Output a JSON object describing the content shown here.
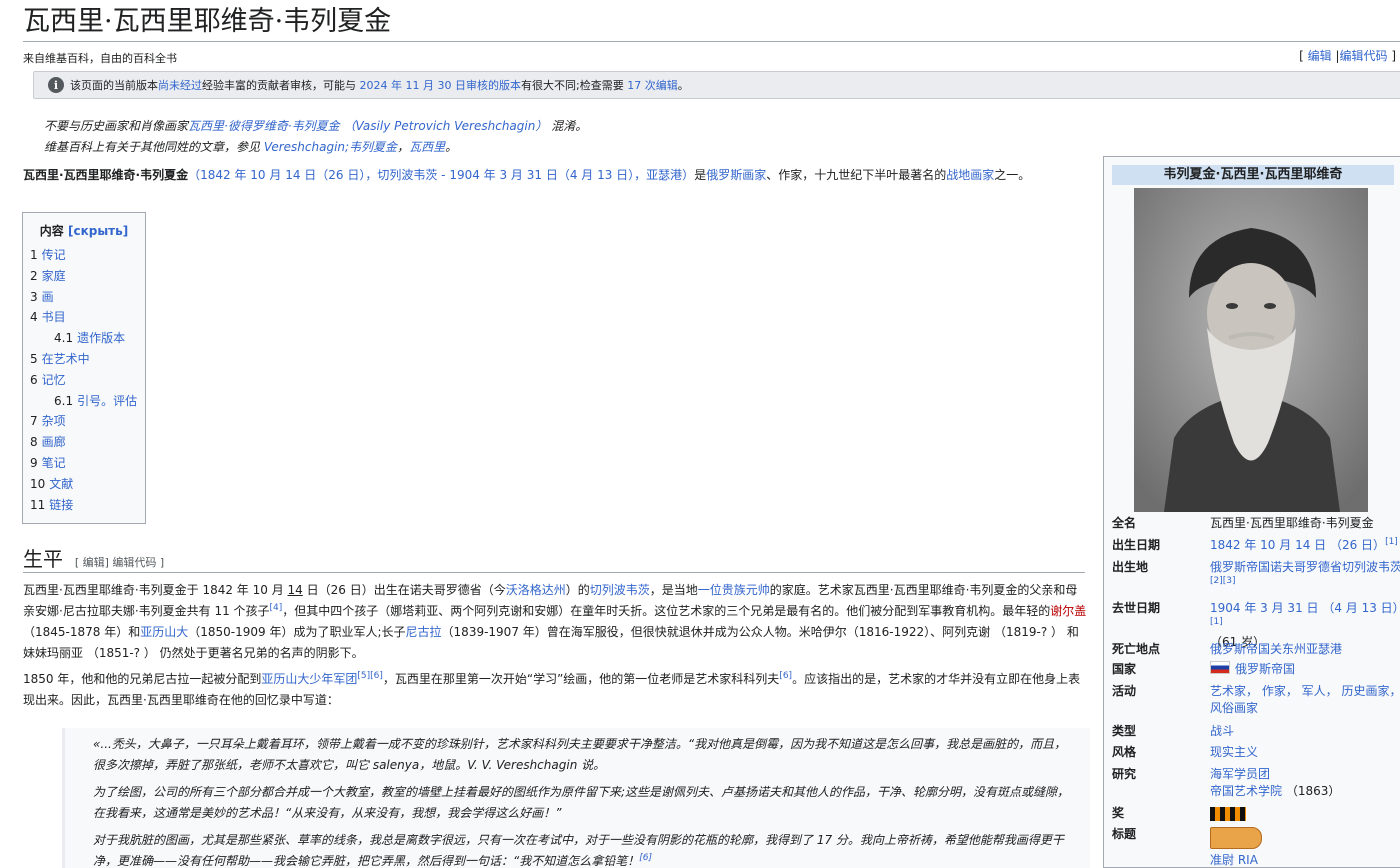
{
  "title": "瓦西里·瓦西里耶维奇·韦列夏金",
  "tagline": "来自维基百科，自由的百科全书",
  "edit_links": {
    "edit": "编辑",
    "edit_code": "编辑代码"
  },
  "review": {
    "pre": "该页面的当前版本",
    "link1": "尚未经过",
    "mid": "经验丰富的贡献者审核，可能与",
    "link2": "2024 年 11 月 30 日审核的版本",
    "mid2": "有很大不同;检查需要",
    "link3": "17 次编辑",
    "end": "。"
  },
  "hatnote1": {
    "pre": "不要与历史画家和肖像画家",
    "link": "瓦西里·彼得罗维奇·韦列夏金",
    "latin": "（Vasily Petrovich Vereshchagin）",
    "end": "混淆。"
  },
  "hatnote2": {
    "pre": "维基百科上有关于其他同姓的文章，参见 ",
    "link1": "Vereshchagin;",
    "link2": "韦列夏金",
    "sep": "，",
    "link3": "瓦西里",
    "end": "。"
  },
  "lead": {
    "name": "瓦西里·瓦西里耶维奇·韦列夏金",
    "birth_link": "（1842 年 10 月 14 日（26 日），切列波韦茨 - 1904 年 3 月 31 日（4 月 13 日），亚瑟港）",
    "is": "是",
    "link_painter": "俄罗斯画家",
    "rest": "、作家，十九世纪下半叶最著名的",
    "link_war": "战地画家",
    "end": "之一。"
  },
  "toc": {
    "title": "内容",
    "hide": "[скрыть]",
    "items": [
      {
        "num": "1",
        "label": "传记",
        "sub": false
      },
      {
        "num": "2",
        "label": "家庭",
        "sub": false
      },
      {
        "num": "3",
        "label": "画",
        "sub": false
      },
      {
        "num": "4",
        "label": "书目",
        "sub": false
      },
      {
        "num": "4.1",
        "label": "遗作版本",
        "sub": true
      },
      {
        "num": "5",
        "label": "在艺术中",
        "sub": false
      },
      {
        "num": "6",
        "label": "记忆",
        "sub": false
      },
      {
        "num": "6.1",
        "label": "引号。评估",
        "sub": true
      },
      {
        "num": "7",
        "label": "杂项",
        "sub": false
      },
      {
        "num": "8",
        "label": "画廊",
        "sub": false
      },
      {
        "num": "9",
        "label": "笔记",
        "sub": false
      },
      {
        "num": "10",
        "label": "文献",
        "sub": false
      },
      {
        "num": "11",
        "label": "链接",
        "sub": false
      }
    ]
  },
  "section": {
    "title": "生平",
    "edit": "[ 编辑] 编辑代码 ]"
  },
  "p1": {
    "a": "瓦西里·瓦西里耶维奇·韦列夏金于 1842 年 10 月 ",
    "b": "14",
    "c": " 日（26 日）出生在诺夫哥罗德省（今",
    "l1": "沃洛格达州",
    "d": "）的",
    "l2": "切列波韦茨",
    "e": "，是当地",
    "l3": "一位贵族元帅",
    "f": "的家庭。艺术家瓦西里·瓦西里耶维奇·韦列夏金的父亲和母亲安娜·尼古拉耶夫娜·韦列夏金共有 11 个孩子",
    "s1": "[4]",
    "g": "，但其中四个孩子（娜塔莉亚、两个阿列克谢和安娜）在童年时夭折。这位艺术家的三个兄弟是最有名的。他们被分配到军事教育机构。最年轻的",
    "l4": "谢尔盖",
    "h": "（1845-1878 年）和",
    "l5": "亚历山大",
    "i": "（1850-1909 年）成为了职业军人;长子",
    "l6": "尼古拉",
    "j": "（1839-1907 年）曾在海军服役，但很快就退休并成为公众人物。米哈伊尔（1816-1922）、阿列克谢 （1819-? ） 和妹妹玛丽亚 （1851-? ） 仍然处于更著名兄弟的名声的阴影下。"
  },
  "p2": {
    "a": "1850 年，他和他的兄弟尼古拉一起被分配到",
    "l1": "亚历山大少年军团",
    "s1": "[5][6]",
    "b": "，瓦西里在那里第一次开始“学习”绘画，他的第一位老师是艺术家科科列夫",
    "s2": "[6]",
    "c": "。应该指出的是，艺术家的才华并没有立即在他身上表现出来。因此，瓦西里·瓦西里耶维奇在他的回忆录中写道："
  },
  "quote": {
    "q1": "«...秃头，大鼻子，一只耳朵上戴着耳环，领带上戴着一成不变的珍珠别针，艺术家科科列夫主要要求干净整洁。“我对他真是倒霉，因为我不知道这是怎么回事，我总是画脏的，而且，很多次擦掉，弄脏了那张纸，老师不太喜欢它，叫它 salenya，地鼠。V. V. Vereshchagin 说。",
    "q2": "为了绘图，公司的所有三个部分都合并成一个大教室，教室的墙壁上挂着最好的图纸作为原件留下来;这些是谢佩列夫、卢基扬诺夫和其他人的作品，干净、轮廓分明，没有斑点或缝隙，在我看来，这通常是美妙的艺术品！“从来没有，从来没有，我想，我会学得这么好画！”",
    "q3": "对于我肮脏的图画，尤其是那些紧张、草率的线条，我总是离数字很远，只有一次在考试中，对于一些没有阴影的花瓶的轮廓，我得到了 17 分。我向上帝祈祷，希望他能帮我画得更干净，更准确——没有任何帮助——我会输它弄脏，把它弄黑，然后得到一句话：“我不知道怎么拿铅笔！",
    "s": "[6]"
  },
  "infobox": {
    "title": "韦列夏金·瓦西里·瓦西里耶维奇",
    "rows": [
      {
        "k": "全名",
        "v": "瓦西里·瓦西里耶维奇·韦列夏金",
        "link": false
      },
      {
        "k": "出生日期",
        "v": "1842 年 10 月 14 日 （26 日）",
        "sup": "[1]",
        "link": true
      },
      {
        "k": "出生地",
        "v": "俄罗斯帝国诺夫哥罗德省切列波韦茨",
        "sup": "[2][3]",
        "link": true
      },
      {
        "k": "去世日期",
        "v": "1904 年 3 月 31 日 （4 月 13 日）",
        "sup": "[1]",
        "v2": "（61 岁）",
        "link": true
      },
      {
        "k": "死亡地点",
        "v": "俄罗斯帝国关东州亚瑟港",
        "link": true
      },
      {
        "k": "国家",
        "v": "俄罗斯帝国",
        "link": true,
        "flag": true
      },
      {
        "k": "活动",
        "v": "艺术家， 作家， 军人， 历史画家， 风俗画家",
        "link": true
      },
      {
        "k": "类型",
        "v": "战斗",
        "link": true
      },
      {
        "k": "风格",
        "v": "现实主义",
        "link": true
      },
      {
        "k": "研究",
        "v": "海军学员团",
        "v2": "帝国艺术学院",
        "v2b": "（1863）",
        "link": true
      },
      {
        "k": "奖",
        "v": "",
        "ribbon": true
      },
      {
        "k": "标题",
        "v": "准尉 RIA",
        "shoulder": true,
        "link": true
      }
    ]
  },
  "colors": {
    "link": "#3366cc",
    "red_link": "#ba0000",
    "infobox_header": "#cee0f2",
    "border": "#a2a9b1"
  }
}
